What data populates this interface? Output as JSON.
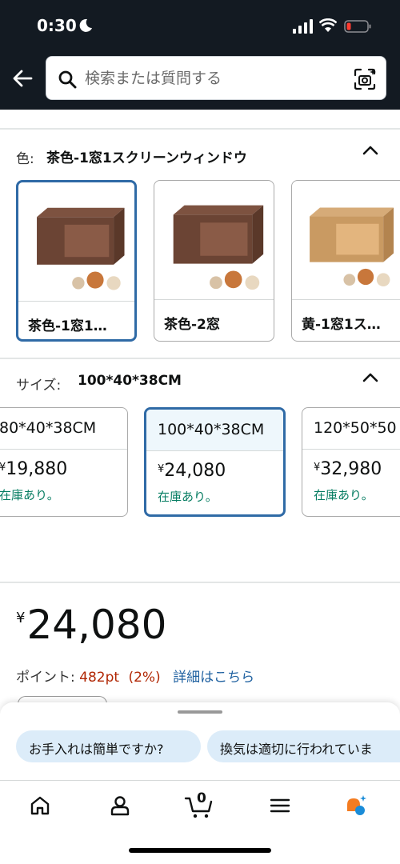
{
  "status_bar": {
    "time": "0:30"
  },
  "search": {
    "placeholder": "検索または質問する"
  },
  "color_section": {
    "label": "色:",
    "value": "茶色-1窓1スクリーンウィンドウ",
    "options": [
      {
        "label": "茶色-1窓1…",
        "color": "#6b4434"
      },
      {
        "label": "茶色-2窓",
        "color": "#6b4434"
      },
      {
        "label": "黄-1窓1ス…",
        "color": "#c99a62"
      }
    ]
  },
  "size_section": {
    "label": "サイズ:",
    "value": "100*40*38CM",
    "options": [
      {
        "name": "80*40*38CM",
        "currency": "¥",
        "price": "19,880",
        "stock": "在庫あり。"
      },
      {
        "name": "100*40*38CM",
        "currency": "¥",
        "price": "24,080",
        "stock": "在庫あり。"
      },
      {
        "name": "120*50*50",
        "currency": "¥",
        "price": "32,980",
        "stock": "在庫あり。"
      }
    ]
  },
  "price": {
    "currency": "¥",
    "amount": "24,080"
  },
  "points": {
    "label": "ポイント:",
    "value": "482pt",
    "percent": "(2%)",
    "link": "詳細はこちら"
  },
  "suggestions": [
    "お手入れは簡単ですか?",
    "換気は適切に行われていま"
  ],
  "nav": [
    "home-icon",
    "account-icon",
    "cart-icon",
    "menu-icon",
    "rufus-icon"
  ],
  "cart_count": "0",
  "colors": {
    "accent": "#2f6aa6",
    "stock_green": "#067d62",
    "price_red": "#b12704",
    "link": "#2162a1",
    "chip": "#dcecf9"
  }
}
